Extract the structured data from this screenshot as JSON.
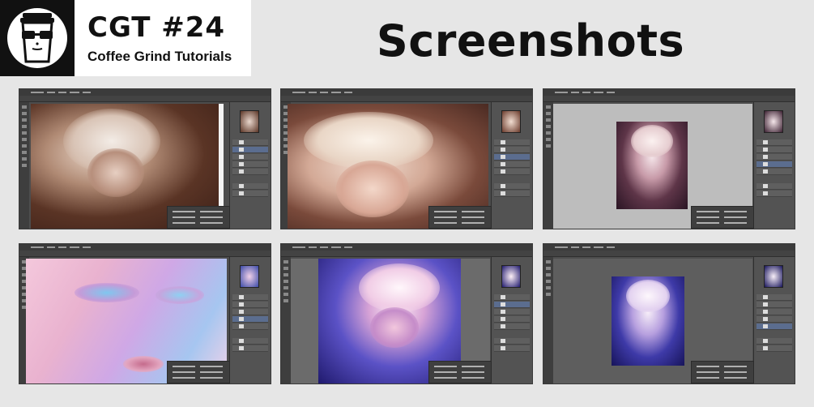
{
  "header": {
    "brand_title": "CGT #24",
    "brand_subtitle": "Coffee Grind Tutorials",
    "page_title": "Screenshots"
  },
  "logo": {
    "icon": "coffee-cup-with-sunglasses-icon"
  },
  "screenshots": [
    {
      "app": "photoshop",
      "art": "sketch-sepia"
    },
    {
      "app": "photoshop",
      "art": "painted-warm"
    },
    {
      "app": "photoshop",
      "art": "portrait-small-grey-canvas"
    },
    {
      "app": "photoshop",
      "art": "closeup-pink-blue"
    },
    {
      "app": "photoshop",
      "art": "portrait-blue-glow"
    },
    {
      "app": "photoshop",
      "art": "portrait-small-dark-canvas"
    }
  ],
  "colors": {
    "background": "#e6e6e6",
    "logo_bg": "#111111",
    "brand_bg": "#ffffff",
    "ps_ui": "#4d4d4d"
  }
}
